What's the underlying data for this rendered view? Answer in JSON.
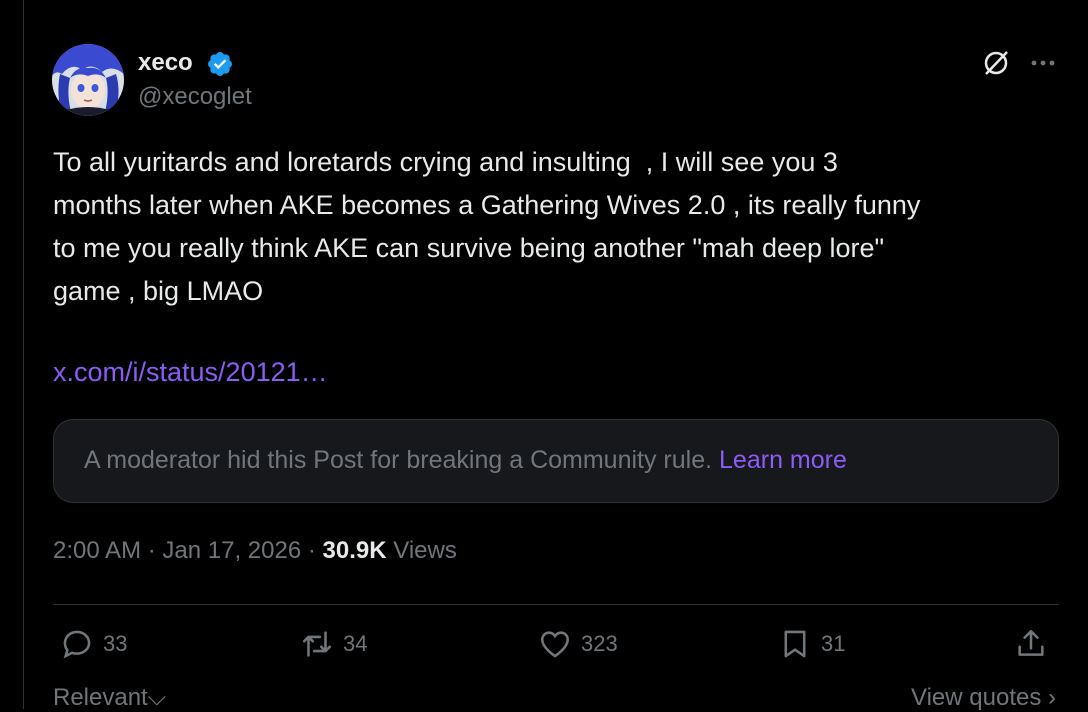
{
  "post": {
    "author": {
      "display_name": "xeco",
      "handle": "@xecoglet",
      "verified": true
    },
    "text": "To all yuritards and loretards crying and insulting  , I will see you 3\nmonths later when AKE becomes a Gathering Wives 2.0 , its really funny\nto me you really think AKE can survive being another \"mah deep lore\"\ngame , big LMAO",
    "link": "x.com/i/status/20121…",
    "moderation": {
      "message": "A moderator hid this Post for breaking a Community rule.",
      "learn_more": "Learn more"
    },
    "time": "2:00 AM",
    "date": "Jan 17, 2026",
    "sep": "·",
    "views_count": "30.9K",
    "views_label": "Views",
    "actions": {
      "replies": "33",
      "reposts": "34",
      "likes": "323",
      "bookmarks": "31"
    }
  },
  "footer": {
    "sort_label": "Relevant",
    "view_quotes": "View quotes"
  },
  "colors": {
    "background": "#000000",
    "link": "#8b5cf6",
    "verified": "#1d9bf0",
    "muted": "#71767b",
    "text": "#e7e9ea"
  }
}
